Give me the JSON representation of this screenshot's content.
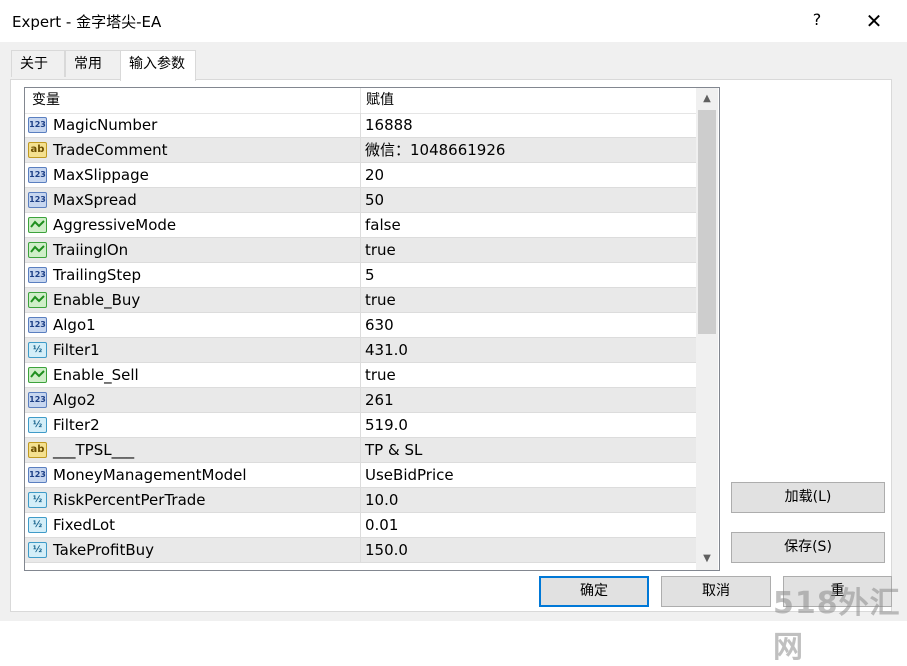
{
  "window": {
    "title": "Expert - 金字塔尖-EA",
    "help_glyph": "?",
    "close_glyph": "✕"
  },
  "tabs": [
    {
      "label": "关于"
    },
    {
      "label": "常用"
    },
    {
      "label": "输入参数"
    }
  ],
  "grid": {
    "columns": [
      "变量",
      "赋值"
    ],
    "rows": [
      {
        "type": "int",
        "icon": "123",
        "name": "MagicNumber",
        "value": "16888"
      },
      {
        "type": "str",
        "icon": "ab",
        "name": "TradeComment",
        "value": "微信：1048661926"
      },
      {
        "type": "int",
        "icon": "123",
        "name": "MaxSlippage",
        "value": "20"
      },
      {
        "type": "int",
        "icon": "123",
        "name": "MaxSpread",
        "value": "50"
      },
      {
        "type": "bool",
        "icon": "bool",
        "name": "AggressiveMode",
        "value": "false"
      },
      {
        "type": "bool",
        "icon": "bool",
        "name": "TraiinglOn",
        "value": "true"
      },
      {
        "type": "int",
        "icon": "123",
        "name": "TrailingStep",
        "value": "5"
      },
      {
        "type": "bool",
        "icon": "bool",
        "name": "Enable_Buy",
        "value": "true"
      },
      {
        "type": "int",
        "icon": "123",
        "name": "Algo1",
        "value": "630"
      },
      {
        "type": "dbl",
        "icon": "½",
        "name": "Filter1",
        "value": "431.0"
      },
      {
        "type": "bool",
        "icon": "bool",
        "name": "Enable_Sell",
        "value": "true"
      },
      {
        "type": "int",
        "icon": "123",
        "name": "Algo2",
        "value": "261"
      },
      {
        "type": "dbl",
        "icon": "½",
        "name": "Filter2",
        "value": "519.0"
      },
      {
        "type": "str",
        "icon": "ab",
        "name": "___TPSL___",
        "value": "TP & SL"
      },
      {
        "type": "int",
        "icon": "123",
        "name": "MoneyManagementModel",
        "value": "UseBidPrice"
      },
      {
        "type": "dbl",
        "icon": "½",
        "name": "RiskPercentPerTrade",
        "value": "10.0"
      },
      {
        "type": "dbl",
        "icon": "½",
        "name": "FixedLot",
        "value": "0.01"
      },
      {
        "type": "dbl",
        "icon": "½",
        "name": "TakeProfitBuy",
        "value": "150.0"
      }
    ]
  },
  "side_buttons": {
    "load": "加载(L)",
    "save": "保存(S)"
  },
  "bottom_buttons": {
    "ok": "确定",
    "cancel": "取消",
    "reset_partial": "重"
  },
  "watermark": "518外汇网"
}
